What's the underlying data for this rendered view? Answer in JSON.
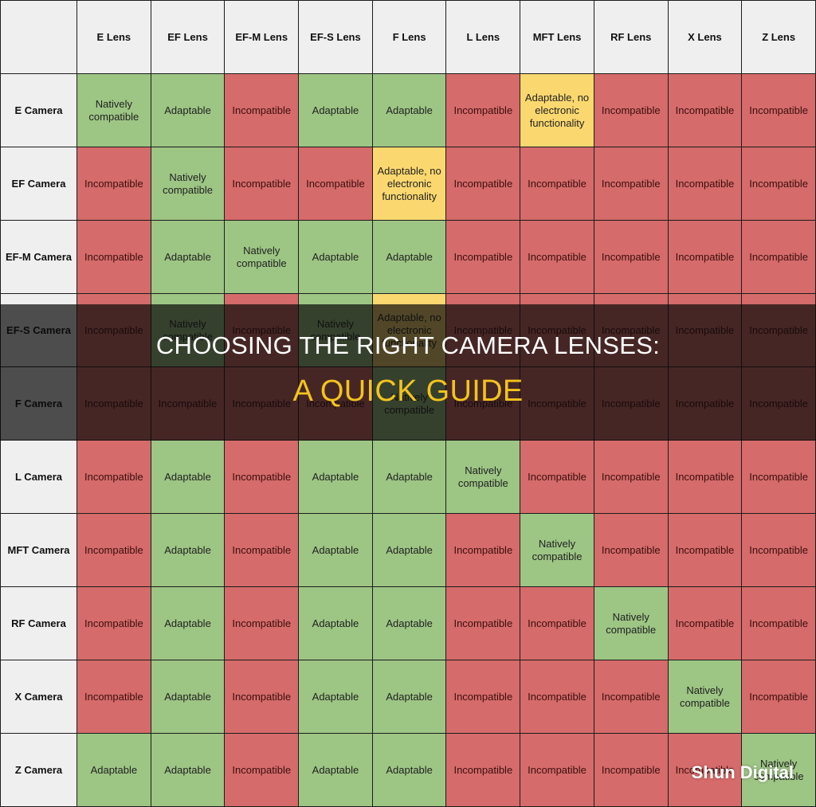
{
  "banner": {
    "title": "CHOOSING THE RIGHT CAMERA LENSES:",
    "subtitle": "A QUICK GUIDE"
  },
  "watermark": "Shun Digital",
  "colors": {
    "natively_compatible": "#9dc584",
    "adaptable": "#9dc584",
    "adaptable_no_electronic": "#fbd86f",
    "incompatible": "#d56b6a",
    "header": "#efefef",
    "banner_subtitle": "#f3c31e"
  },
  "table": {
    "corner": "",
    "columns": [
      "E Lens",
      "EF Lens",
      "EF-M Lens",
      "EF-S Lens",
      "F Lens",
      "L Lens",
      "MFT Lens",
      "RF Lens",
      "X Lens",
      "Z Lens"
    ],
    "rows": [
      {
        "label": "E Camera",
        "cells": [
          {
            "text": "Natively compatible",
            "status": "native"
          },
          {
            "text": "Adaptable",
            "status": "adapt"
          },
          {
            "text": "Incompatible",
            "status": "incompat"
          },
          {
            "text": "Adaptable",
            "status": "adapt"
          },
          {
            "text": "Adaptable",
            "status": "adapt"
          },
          {
            "text": "Incompatible",
            "status": "incompat"
          },
          {
            "text": "Adaptable, no electronic functionality",
            "status": "partial"
          },
          {
            "text": "Incompatible",
            "status": "incompat"
          },
          {
            "text": "Incompatible",
            "status": "incompat"
          },
          {
            "text": "Incompatible",
            "status": "incompat"
          }
        ]
      },
      {
        "label": "EF Camera",
        "cells": [
          {
            "text": "Incompatible",
            "status": "incompat"
          },
          {
            "text": "Natively compatible",
            "status": "native"
          },
          {
            "text": "Incompatible",
            "status": "incompat"
          },
          {
            "text": "Incompatible",
            "status": "incompat"
          },
          {
            "text": "Adaptable, no electronic functionality",
            "status": "partial"
          },
          {
            "text": "Incompatible",
            "status": "incompat"
          },
          {
            "text": "Incompatible",
            "status": "incompat"
          },
          {
            "text": "Incompatible",
            "status": "incompat"
          },
          {
            "text": "Incompatible",
            "status": "incompat"
          },
          {
            "text": "Incompatible",
            "status": "incompat"
          }
        ]
      },
      {
        "label": "EF-M Camera",
        "cells": [
          {
            "text": "Incompatible",
            "status": "incompat"
          },
          {
            "text": "Adaptable",
            "status": "adapt"
          },
          {
            "text": "Natively compatible",
            "status": "native"
          },
          {
            "text": "Adaptable",
            "status": "adapt"
          },
          {
            "text": "Adaptable",
            "status": "adapt"
          },
          {
            "text": "Incompatible",
            "status": "incompat"
          },
          {
            "text": "Incompatible",
            "status": "incompat"
          },
          {
            "text": "Incompatible",
            "status": "incompat"
          },
          {
            "text": "Incompatible",
            "status": "incompat"
          },
          {
            "text": "Incompatible",
            "status": "incompat"
          }
        ]
      },
      {
        "label": "EF-S Camera",
        "cells": [
          {
            "text": "Incompatible",
            "status": "incompat"
          },
          {
            "text": "Natively compatible",
            "status": "native"
          },
          {
            "text": "Incompatible",
            "status": "incompat"
          },
          {
            "text": "Natively compatible",
            "status": "native"
          },
          {
            "text": "Adaptable, no electronic functionality",
            "status": "partial"
          },
          {
            "text": "Incompatible",
            "status": "incompat"
          },
          {
            "text": "Incompatible",
            "status": "incompat"
          },
          {
            "text": "Incompatible",
            "status": "incompat"
          },
          {
            "text": "Incompatible",
            "status": "incompat"
          },
          {
            "text": "Incompatible",
            "status": "incompat"
          }
        ]
      },
      {
        "label": "F Camera",
        "cells": [
          {
            "text": "Incompatible",
            "status": "incompat"
          },
          {
            "text": "Incompatible",
            "status": "incompat"
          },
          {
            "text": "Incompatible",
            "status": "incompat"
          },
          {
            "text": "Incompatible",
            "status": "incompat"
          },
          {
            "text": "Natively compatible",
            "status": "native"
          },
          {
            "text": "Incompatible",
            "status": "incompat"
          },
          {
            "text": "Incompatible",
            "status": "incompat"
          },
          {
            "text": "Incompatible",
            "status": "incompat"
          },
          {
            "text": "Incompatible",
            "status": "incompat"
          },
          {
            "text": "Incompatible",
            "status": "incompat"
          }
        ]
      },
      {
        "label": "L Camera",
        "cells": [
          {
            "text": "Incompatible",
            "status": "incompat"
          },
          {
            "text": "Adaptable",
            "status": "adapt"
          },
          {
            "text": "Incompatible",
            "status": "incompat"
          },
          {
            "text": "Adaptable",
            "status": "adapt"
          },
          {
            "text": "Adaptable",
            "status": "adapt"
          },
          {
            "text": "Natively compatible",
            "status": "native"
          },
          {
            "text": "Incompatible",
            "status": "incompat"
          },
          {
            "text": "Incompatible",
            "status": "incompat"
          },
          {
            "text": "Incompatible",
            "status": "incompat"
          },
          {
            "text": "Incompatible",
            "status": "incompat"
          }
        ]
      },
      {
        "label": "MFT Camera",
        "cells": [
          {
            "text": "Incompatible",
            "status": "incompat"
          },
          {
            "text": "Adaptable",
            "status": "adapt"
          },
          {
            "text": "Incompatible",
            "status": "incompat"
          },
          {
            "text": "Adaptable",
            "status": "adapt"
          },
          {
            "text": "Adaptable",
            "status": "adapt"
          },
          {
            "text": "Incompatible",
            "status": "incompat"
          },
          {
            "text": "Natively compatible",
            "status": "native"
          },
          {
            "text": "Incompatible",
            "status": "incompat"
          },
          {
            "text": "Incompatible",
            "status": "incompat"
          },
          {
            "text": "Incompatible",
            "status": "incompat"
          }
        ]
      },
      {
        "label": "RF Camera",
        "cells": [
          {
            "text": "Incompatible",
            "status": "incompat"
          },
          {
            "text": "Adaptable",
            "status": "adapt"
          },
          {
            "text": "Incompatible",
            "status": "incompat"
          },
          {
            "text": "Adaptable",
            "status": "adapt"
          },
          {
            "text": "Adaptable",
            "status": "adapt"
          },
          {
            "text": "Incompatible",
            "status": "incompat"
          },
          {
            "text": "Incompatible",
            "status": "incompat"
          },
          {
            "text": "Natively compatible",
            "status": "native"
          },
          {
            "text": "Incompatible",
            "status": "incompat"
          },
          {
            "text": "Incompatible",
            "status": "incompat"
          }
        ]
      },
      {
        "label": "X Camera",
        "cells": [
          {
            "text": "Incompatible",
            "status": "incompat"
          },
          {
            "text": "Adaptable",
            "status": "adapt"
          },
          {
            "text": "Incompatible",
            "status": "incompat"
          },
          {
            "text": "Adaptable",
            "status": "adapt"
          },
          {
            "text": "Adaptable",
            "status": "adapt"
          },
          {
            "text": "Incompatible",
            "status": "incompat"
          },
          {
            "text": "Incompatible",
            "status": "incompat"
          },
          {
            "text": "Incompatible",
            "status": "incompat"
          },
          {
            "text": "Natively compatible",
            "status": "native"
          },
          {
            "text": "Incompatible",
            "status": "incompat"
          }
        ]
      },
      {
        "label": "Z Camera",
        "cells": [
          {
            "text": "Adaptable",
            "status": "adapt"
          },
          {
            "text": "Adaptable",
            "status": "adapt"
          },
          {
            "text": "Incompatible",
            "status": "incompat"
          },
          {
            "text": "Adaptable",
            "status": "adapt"
          },
          {
            "text": "Adaptable",
            "status": "adapt"
          },
          {
            "text": "Incompatible",
            "status": "incompat"
          },
          {
            "text": "Incompatible",
            "status": "incompat"
          },
          {
            "text": "Incompatible",
            "status": "incompat"
          },
          {
            "text": "Incompatible",
            "status": "incompat"
          },
          {
            "text": "Natively compatible",
            "status": "native"
          }
        ]
      }
    ]
  }
}
